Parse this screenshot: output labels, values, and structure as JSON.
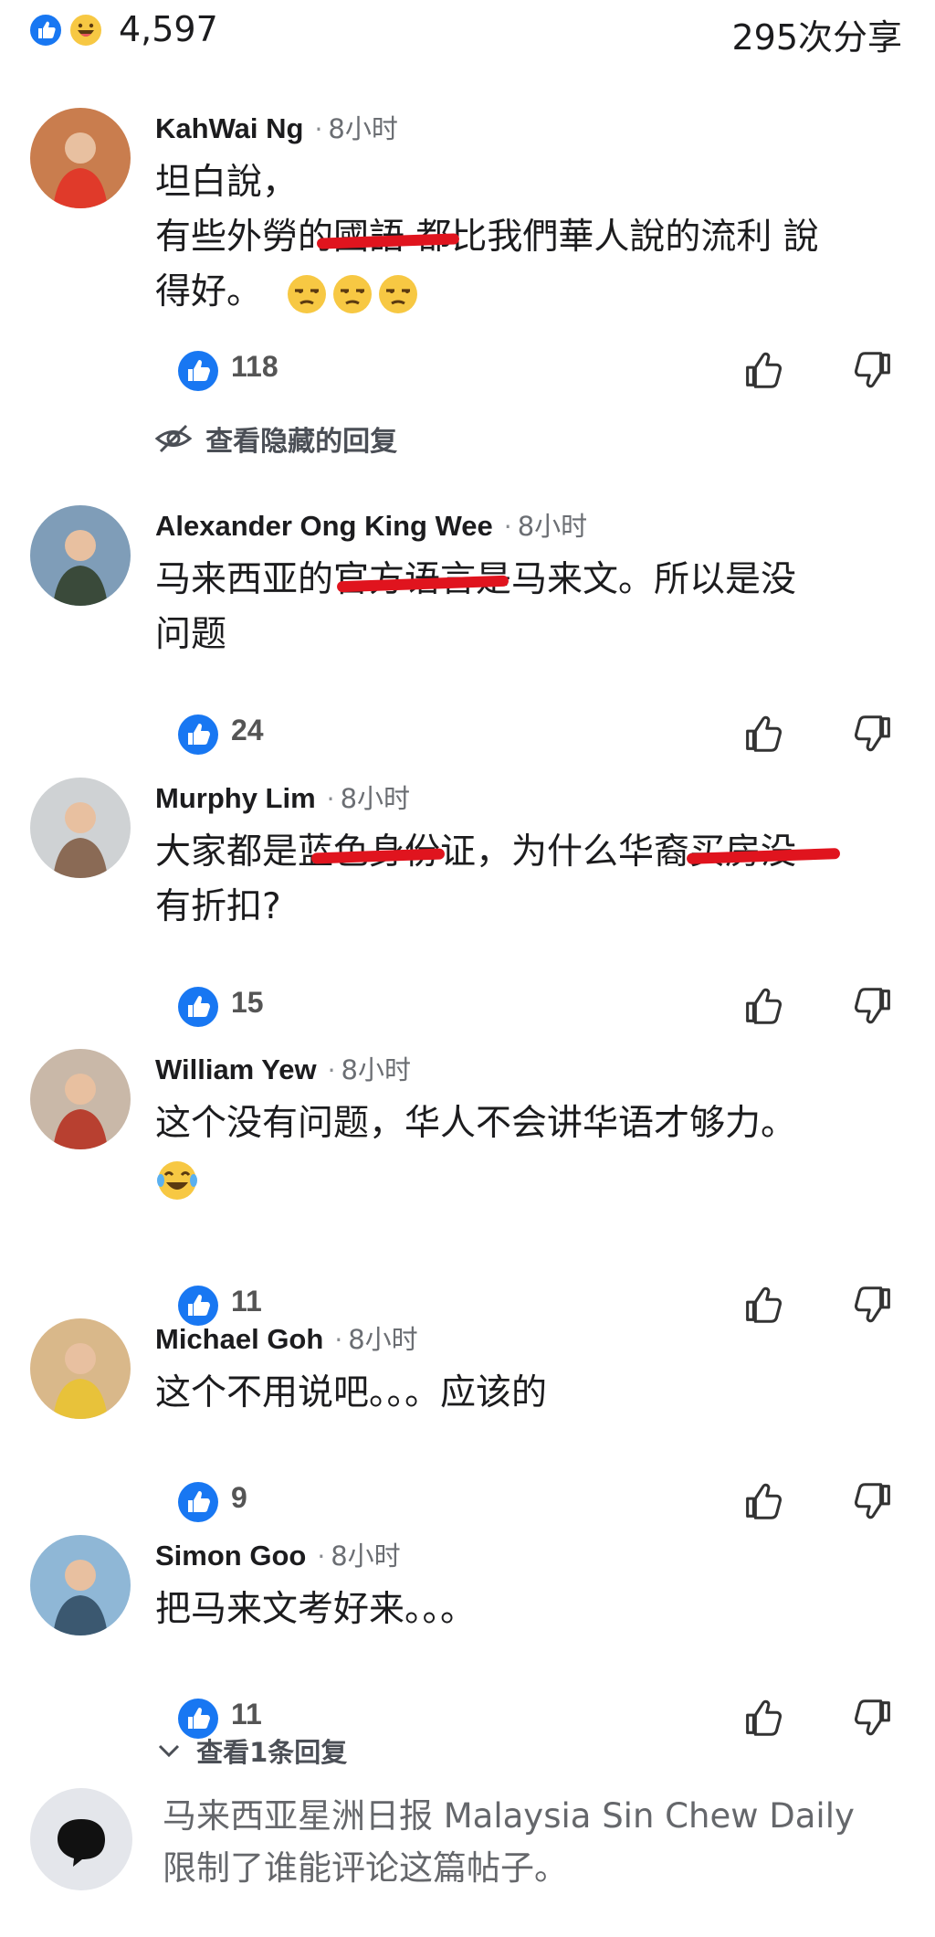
{
  "reactions": {
    "count": "4,597",
    "shares": "295次分享"
  },
  "comments": [
    {
      "name": "KahWai Ng",
      "time": "8小时",
      "lines": [
        "坦白說，",
        "有些外勞的國語 都比我們華人說的流利 說",
        "得好。"
      ],
      "emoji_count": 3,
      "emoji_type": "unamused-face-icon",
      "likes": "118",
      "avatar_colors": [
        "#c97d4e",
        "#e03a2a"
      ]
    },
    {
      "name": "Alexander Ong King Wee",
      "time": "8小时",
      "lines": [
        "马来西亚的官方语言是马来文。所以是没",
        "问题"
      ],
      "likes": "24",
      "avatar_colors": [
        "#7f9db8",
        "#3a4a3a"
      ]
    },
    {
      "name": "Murphy Lim",
      "time": "8小时",
      "lines": [
        "大家都是蓝色身份证，为什么华裔买房没",
        "有折扣?"
      ],
      "likes": "15",
      "avatar_colors": [
        "#cfd2d4",
        "#8a6a55"
      ]
    },
    {
      "name": "William Yew",
      "time": "8小时",
      "lines": [
        "这个没有问题，华人不会讲华语才够力。"
      ],
      "emoji_count": 1,
      "emoji_type": "laughing-tears-icon",
      "likes": "11",
      "avatar_colors": [
        "#c9b8a8",
        "#b84030"
      ]
    },
    {
      "name": "Michael Goh",
      "time": "8小时",
      "lines": [
        "这个不用说吧。。。应该的"
      ],
      "likes": "9",
      "avatar_colors": [
        "#d9b88a",
        "#e8c23a"
      ]
    },
    {
      "name": "Simon Goo",
      "time": "8小时",
      "lines": [
        "把马来文考好来。。。"
      ],
      "likes": "11",
      "avatar_colors": [
        "#8fb7d6",
        "#3b5870"
      ]
    }
  ],
  "hidden_replies_label": "查看隐藏的回复",
  "more_replies_label": "查看1条回复",
  "restriction_text": "马来西亚星洲日报 Malaysia Sin Chew Daily 限制了谁能评论这篇帖子。",
  "colors": {
    "accent": "#1877f2",
    "redact": "#e0141e",
    "muted": "#65676b"
  }
}
